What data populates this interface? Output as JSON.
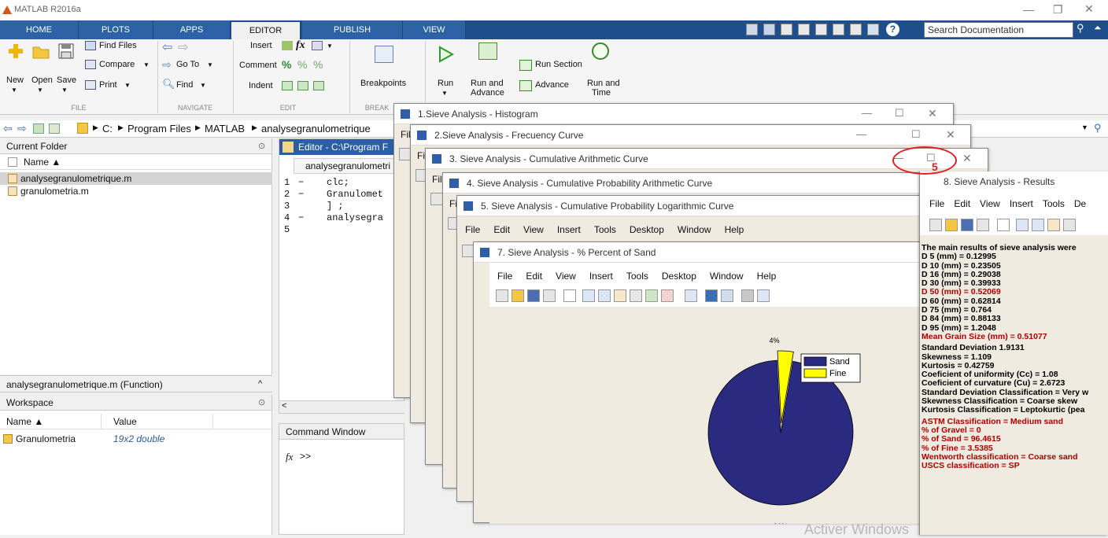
{
  "app": {
    "title": "MATLAB R2016a"
  },
  "tabs": [
    "HOME",
    "PLOTS",
    "APPS",
    "EDITOR",
    "PUBLISH",
    "VIEW"
  ],
  "active_tab": "EDITOR",
  "search": {
    "placeholder": "Search Documentation"
  },
  "ribbon": {
    "file": {
      "new": "New",
      "open": "Open",
      "save": "Save",
      "find_files": "Find Files",
      "compare": "Compare",
      "print": "Print",
      "group": "FILE"
    },
    "navigate": {
      "goto": "Go To",
      "find": "Find",
      "group": "NAVIGATE"
    },
    "edit": {
      "insert": "Insert",
      "comment": "Comment",
      "indent": "Indent",
      "group": "EDIT"
    },
    "breakpoints": {
      "label": "Breakpoints",
      "group": "BREAK"
    },
    "run": {
      "run": "Run",
      "run_advance_1": "Run and",
      "run_advance_2": "Advance",
      "run_section": "Run Section",
      "advance": "Advance",
      "run_time_1": "Run and",
      "run_time_2": "Time"
    }
  },
  "address": {
    "drive": "C:",
    "folder1": "Program Files",
    "folder2": "MATLAB",
    "folder3": "analysegranulometrique"
  },
  "current_folder": {
    "title": "Current Folder",
    "col_name": "Name ▲",
    "files": [
      "analysegranulometrique.m",
      "granulometria.m"
    ],
    "details": "analysegranulometrique.m  (Function)"
  },
  "workspace": {
    "title": "Workspace",
    "col_name": "Name ▲",
    "col_value": "Value",
    "rows": [
      {
        "name": "Granulometria",
        "value": "19x2 double"
      }
    ]
  },
  "editor": {
    "title": "Editor - C:\\Program F",
    "tab": "analysegranulometri",
    "lines": [
      {
        "n": "1",
        "mark": "−",
        "code": "clc;"
      },
      {
        "n": "2",
        "mark": "−",
        "code": "Granulomet"
      },
      {
        "n": "3",
        "mark": "",
        "code": "] ;"
      },
      {
        "n": "4",
        "mark": "−",
        "code": "analysegra"
      },
      {
        "n": "5",
        "mark": "",
        "code": ""
      }
    ]
  },
  "command_window": {
    "title": "Command Window",
    "prompt": ">>",
    "fx": "fx"
  },
  "figures": [
    "1.Sieve Analysis - Histogram",
    "2.Sieve Analysis - Frecuency Curve",
    "3. Sieve Analysis - Cumulative Arithmetic Curve",
    "4. Sieve Analysis - Cumulative Probability Arithmetic Curve",
    "5. Sieve Analysis - Cumulative Probability Logarithmic Curve",
    "7. Sieve Analysis - % Percent of Sand",
    "8. Sieve Analysis - Results"
  ],
  "fig_menu": [
    "File",
    "Edit",
    "View",
    "Insert",
    "Tools",
    "Desktop",
    "Window",
    "Help"
  ],
  "fig_menu_short": "Fil",
  "annotation": {
    "number": "5"
  },
  "chart_data": {
    "type": "pie",
    "labels": [
      "Sand",
      "Fine"
    ],
    "values": [
      96.4615,
      3.5385
    ],
    "slice_labels": [
      "96%",
      "4%"
    ],
    "colors": [
      "#2a2a80",
      "#ffff00"
    ],
    "legend": "top-right"
  },
  "results": {
    "menu": [
      "File",
      "Edit",
      "View",
      "Insert",
      "Tools",
      "De"
    ],
    "lines": [
      {
        "t": "The main results of sieve analysis were",
        "c": "#000"
      },
      {
        "t": "D 5 (mm) = 0.12995",
        "c": "#000"
      },
      {
        "t": "D 10 (mm) = 0.23505",
        "c": "#000"
      },
      {
        "t": "D 16 (mm) = 0.29038",
        "c": "#000"
      },
      {
        "t": "D 30 (mm) = 0.39933",
        "c": "#000"
      },
      {
        "t": "D 50 (mm) = 0.52069",
        "c": "#b00000"
      },
      {
        "t": "D 60 (mm) = 0.62814",
        "c": "#000"
      },
      {
        "t": "D 75 (mm) = 0.764",
        "c": "#000"
      },
      {
        "t": "D 84 (mm) = 0.88133",
        "c": "#000"
      },
      {
        "t": "D 95 (mm) = 1.2048",
        "c": "#000"
      },
      {
        "t": "Mean Grain Size  (mm) = 0.51077",
        "c": "#b00000"
      },
      {
        "t": "Standard Deviation 1.9131",
        "c": "#000"
      },
      {
        "t": "Skewness = 1.109",
        "c": "#000"
      },
      {
        "t": "Kurtosis = 0.42759",
        "c": "#000"
      },
      {
        "t": "Coeficient of uniformity (Cc) = 1.08",
        "c": "#000"
      },
      {
        "t": "Coeficient of curvature (Cu) = 2.6723",
        "c": "#000"
      },
      {
        "t": "Standard Deviation Classification = Very w",
        "c": "#000"
      },
      {
        "t": "Skewness Classification = Coarse skew",
        "c": "#000"
      },
      {
        "t": "Kurtosis Classification = Leptokurtic (pea",
        "c": "#000"
      },
      {
        "t": "ASTM Classification = Medium sand",
        "c": "#b00000"
      },
      {
        "t": "% of Gravel = 0",
        "c": "#b00000"
      },
      {
        "t": "% of Sand = 96.4615",
        "c": "#b00000"
      },
      {
        "t": "% of Fine = 3.5385",
        "c": "#b00000"
      },
      {
        "t": "Wentworth classification = Coarse sand",
        "c": "#b00000"
      },
      {
        "t": "USCS classification = SP",
        "c": "#b00000"
      }
    ]
  },
  "watermark": "Activer Windows",
  "colors": {
    "ribbon_tabs": "#1f4e8c",
    "annotation": "#e02020"
  }
}
